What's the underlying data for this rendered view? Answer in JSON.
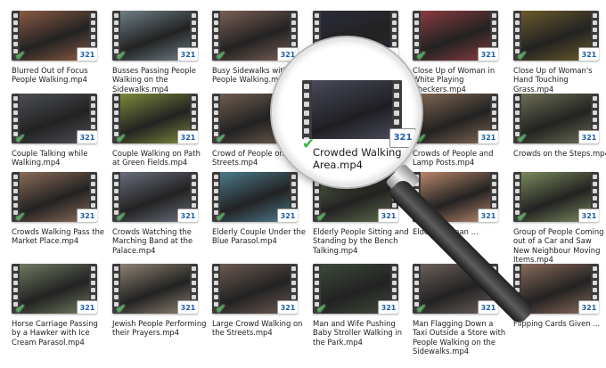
{
  "badge_text": "321",
  "check_glyph": "✔",
  "videos": [
    {
      "label": "Blurred Out of Focus People Walking.mp4",
      "tint": "#8a5a42"
    },
    {
      "label": "Busses Passing People Walking on the Sidewalks.mp4",
      "tint": "#6f7f86"
    },
    {
      "label": "Busy Sidewalks with People Walking.mp4",
      "tint": "#7a5f55"
    },
    {
      "label": "",
      "tint": "#2b2b3a"
    },
    {
      "label": "Close Up of Woman in White Playing Checkers.mp4",
      "tint": "#8a3c40"
    },
    {
      "label": "Close Up of Woman's Hand Touching Grass.mp4",
      "tint": "#6a5a2a"
    },
    {
      "label": "Couple Talking while Walking.mp4",
      "tint": "#4d4f55"
    },
    {
      "label": "Couple Walking on Path at Green Fields.mp4",
      "tint": "#7c8a3a"
    },
    {
      "label": "Crowd of People on Streets.mp4",
      "tint": "#6e5c50"
    },
    {
      "label": "",
      "tint": "#333"
    },
    {
      "label": "Crowds of People and Lamp Posts.mp4",
      "tint": "#7f6652"
    },
    {
      "label": "Crowds on the Steps.mp4",
      "tint": "#6d6e54"
    },
    {
      "label": "Crowds Walking Pass the Market Place.mp4",
      "tint": "#8b6b57"
    },
    {
      "label": "Crowds Watching the Marching Band at the Palace.mp4",
      "tint": "#6a6e7c"
    },
    {
      "label": "Elderly Couple Under the Blue Parasol.mp4",
      "tint": "#4d7a8c"
    },
    {
      "label": "Elderly People Sitting and Standing by the Bench Talking.mp4",
      "tint": "#5d6b4a"
    },
    {
      "label": "Elderly Woman ...",
      "tint": "#b8866a"
    },
    {
      "label": "Group of People Coming out of a Car and Saw New Neighbour Moving Items.mp4",
      "tint": "#7b8a5c"
    },
    {
      "label": "Horse Carriage Passing by a Hawker with Ice Cream Parasol.mp4",
      "tint": "#6f7a62"
    },
    {
      "label": "Jewish People Performing their Prayers.mp4",
      "tint": "#8d8272"
    },
    {
      "label": "Large Crowd Walking on the Streets.mp4",
      "tint": "#6b5a52"
    },
    {
      "label": "Man and Wife Pushing Baby Stroller Walking in the Park.mp4",
      "tint": "#3d4a3a"
    },
    {
      "label": "Man Flagging Down a Taxi Outside a Store with People Walking on the Sidewalks.mp4",
      "tint": "#6a5f5a"
    },
    {
      "label": "Flipping Cards Given ...",
      "tint": "#8a6a5a"
    }
  ],
  "magnified": {
    "label": "Crowded Walking Area.mp4",
    "tint": "#4a4a5a"
  }
}
